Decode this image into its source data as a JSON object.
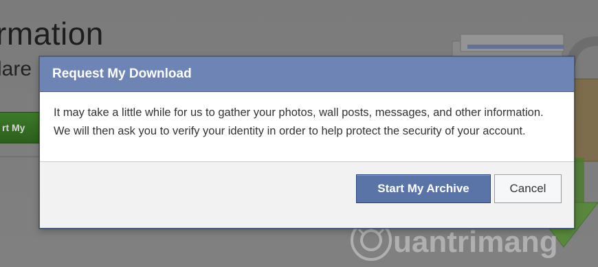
{
  "background": {
    "heading": "rmation",
    "subheading": "lare",
    "button_label": "rt My"
  },
  "dialog": {
    "title": "Request My Download",
    "message": "It may take a little while for us to gather your photos, wall posts, messages, and other information. We will then ask you to verify your identity in order to help protect the security of your account.",
    "primary_button": "Start My Archive",
    "secondary_button": "Cancel"
  },
  "watermark": {
    "text": "uantrimang"
  },
  "colors": {
    "header": "#6d84b4",
    "primary_button": "#5b74a8",
    "overlay": "#7f7f7f",
    "background_button": "#3d7a29"
  }
}
